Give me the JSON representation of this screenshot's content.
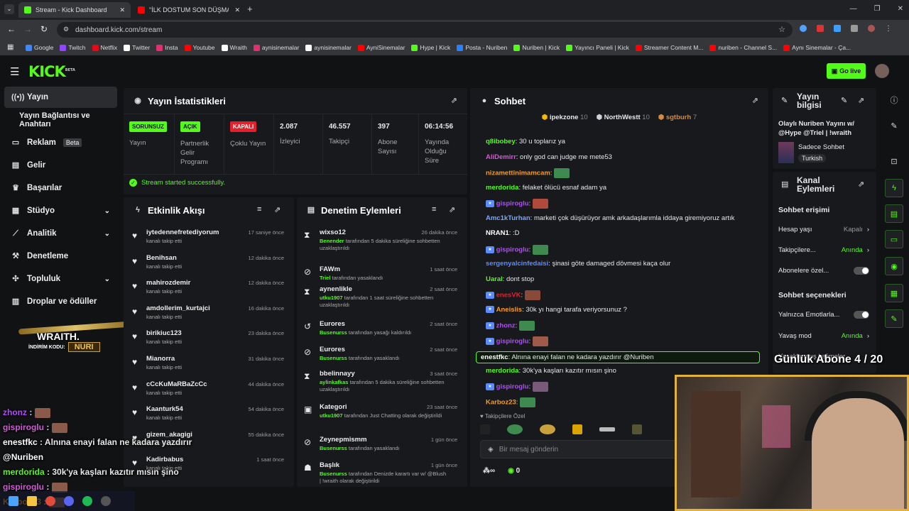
{
  "browser": {
    "tabs": [
      {
        "label": "Stream - Kick Dashboard"
      },
      {
        "label": "\"İLK DOSTUM SON DÜŞMANIM"
      }
    ],
    "url": "dashboard.kick.com/stream",
    "bookmarks": [
      "Google",
      "Twitch",
      "Netflix",
      "Twitter",
      "Insta",
      "Youtube",
      "Wraith",
      "aynisinemalar",
      "aynisinemalar",
      "AyniSinemalar",
      "Hype | Kick",
      "Posta - Nuriben",
      "Nuriben | Kick",
      "Yayıncı Paneli | Kick",
      "Streamer Content M...",
      "nuriben - Channel S...",
      "Aynı Sinemalar - Ça..."
    ]
  },
  "header": {
    "logo": "KICK",
    "logo_sup": "BETA",
    "go_live": "Go live"
  },
  "sidenav": {
    "items": [
      {
        "label": "Yayın",
        "icon": "broadcast-icon"
      },
      {
        "label": "Yayın Bağlantısı ve Anahtarı",
        "icon": ""
      },
      {
        "label": "Reklam",
        "badge": "Beta",
        "icon": "ad-icon"
      },
      {
        "label": "Gelir",
        "icon": "dollar-icon"
      },
      {
        "label": "Başarılar",
        "icon": "trophy-icon"
      },
      {
        "label": "Stüdyo",
        "icon": "studio-icon"
      },
      {
        "label": "Analitik",
        "icon": "analytics-icon"
      },
      {
        "label": "Denetleme",
        "icon": "hammer-icon"
      },
      {
        "label": "Topluluk",
        "icon": "community-icon"
      },
      {
        "label": "Droplar ve ödüller",
        "icon": "drops-icon"
      }
    ]
  },
  "promo": {
    "brand": "WRAITH.",
    "code_label": "İNDİRİM KODU:",
    "code": "NURI"
  },
  "stats": {
    "title": "Yayın İstatistikleri",
    "items": [
      {
        "badge": "SORUNSUZ",
        "label": "Yayın",
        "color": "#53fc18"
      },
      {
        "badge": "AÇIK",
        "label": "Partnerlik Gelir Programı",
        "color": "#53fc18"
      },
      {
        "badge": "KAPALI",
        "label": "Çoklu Yayın",
        "color": "#e5202b"
      },
      {
        "value": "2.087",
        "label": "İzleyici"
      },
      {
        "value": "46.557",
        "label": "Takipçi"
      },
      {
        "value": "397",
        "label": "Abone Sayısı"
      },
      {
        "value": "06:14:56",
        "label": "Yayında Olduğu Süre"
      }
    ],
    "success": "Stream started successfully."
  },
  "activity": {
    "title": "Etkinlik Akışı",
    "rows": [
      {
        "name": "iytedennefretediyorum",
        "sub": "kanalı takip etti",
        "time": "17 saniye önce"
      },
      {
        "name": "Benihsan",
        "sub": "kanalı takip etti",
        "time": "12 dakika önce"
      },
      {
        "name": "mahirozdemir",
        "sub": "kanalı takip etti",
        "time": "12 dakika önce"
      },
      {
        "name": "amdollerim_kurtajci",
        "sub": "kanalı takip etti",
        "time": "16 dakika önce"
      },
      {
        "name": "birikiuc123",
        "sub": "kanalı takip etti",
        "time": "23 dakika önce"
      },
      {
        "name": "Mianorra",
        "sub": "kanalı takip etti",
        "time": "31 dakika önce"
      },
      {
        "name": "cCcKuMaRBaZcCc",
        "sub": "kanalı takip etti",
        "time": "44 dakika önce"
      },
      {
        "name": "Kaanturk54",
        "sub": "kanalı takip etti",
        "time": "54 dakika önce"
      },
      {
        "name": "gizem_akagigi",
        "sub": "kanalı takip etti",
        "time": "55 dakika önce"
      },
      {
        "name": "Kadirbabus",
        "sub": "kanalı takip etti",
        "time": "1 saat önce"
      }
    ]
  },
  "moderation": {
    "title": "Denetim Eylemleri",
    "rows": [
      {
        "name": "wixso12",
        "actor": "Benender",
        "text": "tarafından 5 dakika süreliğine sohbetten uzaklaştırıldı",
        "time": "26 dakika önce",
        "icon": "hourglass-icon"
      },
      {
        "name": "FAWm",
        "actor": "Triel",
        "text": "tarafından yasaklandı",
        "time": "1 saat önce",
        "icon": "ban-icon"
      },
      {
        "name": "aynenlikle",
        "actor": "utku1907",
        "text": "tarafından 1 saat süreliğine sohbetten uzaklaştırıldı",
        "time": "2 saat önce",
        "icon": "hourglass-icon"
      },
      {
        "name": "Eurores",
        "actor": "Busenurss",
        "text": "tarafından yasağı kaldırıldı",
        "time": "2 saat önce",
        "icon": "undo-icon"
      },
      {
        "name": "Eurores",
        "actor": "Busenurss",
        "text": "tarafından yasaklandı",
        "time": "2 saat önce",
        "icon": "ban-icon"
      },
      {
        "name": "bbelinnayy",
        "actor": "aylinkafkas",
        "text": "tarafından 5 dakika süreliğine sohbetten uzaklaştırıldı",
        "time": "3 saat önce",
        "icon": "hourglass-icon"
      },
      {
        "name": "Kategori",
        "actor": "utku1907",
        "text": "tarafından Just Chatting olarak değiştirildi",
        "time": "23 saat önce",
        "icon": "category-icon"
      },
      {
        "name": "Zeynepmismm",
        "actor": "Busenurss",
        "text": "tarafından yasaklandı",
        "time": "1 gün önce",
        "icon": "ban-icon"
      },
      {
        "name": "Başlık",
        "actor": "Busenurss",
        "text": "tarafından Denizde karartı var w/ @Blush | !wraith olarak değiştirildi",
        "time": "1 gün önce",
        "icon": "title-icon"
      }
    ]
  },
  "chat": {
    "title": "Sohbet",
    "top_gifters": [
      {
        "name": "ipekzone",
        "count": "10",
        "color": "#f5b800"
      },
      {
        "name": "NorthWestt",
        "count": "10",
        "color": "#cfd3d8"
      },
      {
        "name": "sgtburh",
        "count": "7",
        "color": "#d98a3a"
      }
    ],
    "messages": [
      {
        "user": "q8ibobey",
        "color": "#53fc18",
        "text": "30 u toplarız ya",
        "emote": false
      },
      {
        "user": "AliDemirr",
        "color": "#d15ad6",
        "text": "only god can judge me mete53",
        "emote": false
      },
      {
        "user": "nizamettinimamcam",
        "color": "#f59b24",
        "text": "",
        "emote": true
      },
      {
        "user": "merdorida",
        "color": "#53fc18",
        "text": "felaket ölücü esnaf adam ya",
        "emote": false
      },
      {
        "user": "gispiroglu",
        "color": "#b34bff",
        "text": "",
        "emote": true
      },
      {
        "user": "Amc1kTurhan",
        "color": "#7aa6ff",
        "text": "marketi çok düşürüyor amk arkadaşlarımla iddaya giremiyoruz artık",
        "emote": false
      },
      {
        "user": "NRAN1",
        "color": "#ffffff",
        "text": ":D",
        "emote": false
      },
      {
        "user": "gispiroglu",
        "color": "#b34bff",
        "text": "",
        "emote": true
      },
      {
        "user": "sergenyalcinfedaisi",
        "color": "#5b8cff",
        "text": "şinasi göte damaged dövmesi kaça olur",
        "emote": false
      },
      {
        "user": "Uaral",
        "color": "#53fc18",
        "text": "dont stop",
        "emote": false
      },
      {
        "user": "enesVK",
        "color": "#e5202b",
        "text": "",
        "emote": true
      },
      {
        "user": "Aneislis",
        "color": "#f59b24",
        "text": "30k yı hangi tarafa veriyorsunuz ?",
        "emote": false
      },
      {
        "user": "zhonz",
        "color": "#b34bff",
        "text": "",
        "emote": true
      },
      {
        "user": "gispiroglu",
        "color": "#b34bff",
        "text": "",
        "emote": true
      },
      {
        "user": "enestfkc",
        "color": "#ffffff",
        "text": "Alnına enayi falan ne kadara yazdırır @Nuriben",
        "emote": false
      },
      {
        "user": "merdorida",
        "color": "#53fc18",
        "text": "30k'ya kaşları kazıtır mısın şino",
        "emote": false
      },
      {
        "user": "gispiroglu",
        "color": "#b34bff",
        "text": "",
        "emote": true
      },
      {
        "user": "Karboz23",
        "color": "#f59b24",
        "text": "",
        "emote": true
      }
    ],
    "followers_only": "Takipçilere Özel",
    "placeholder": "Bir mesaj gönderin",
    "count": "0"
  },
  "stream_info": {
    "title": "Yayın bilgisi",
    "stream_title": "Olaylı Nuriben Yayını w/ @Hype @Triel | !wraith",
    "category": "Sadece Sohbet",
    "language": "Turkish"
  },
  "channel_actions": {
    "title": "Kanal Eylemleri",
    "chat_access": "Sohbet erişimi",
    "account_age": {
      "label": "Hesap yaşı",
      "value": "Kapalı"
    },
    "followers": {
      "label": "Takipçilere...",
      "value": "Anında"
    },
    "subs": {
      "label": "Abonelere özel..."
    },
    "chat_options": "Sohbet seçenekleri",
    "emotes_only": {
      "label": "Yalnızca Emotlarla..."
    },
    "slow_mode": {
      "label": "Yavaş mod",
      "value": "Anında"
    },
    "blocked_words": "Yasaklanmış kelimeler"
  },
  "overlay": {
    "daily_sub": "Günlük Abone 4 / 20",
    "chat": [
      {
        "user": "zhonz",
        "color": "#b34bff",
        "text": ":"
      },
      {
        "user": "gispiroglu",
        "color": "#d15ad6",
        "text": ":"
      },
      {
        "user": "enestfkc",
        "color": "#ffffff",
        "text": ": Alnına enayi falan ne kadara yazdırır"
      },
      {
        "user": "@Nuriben",
        "color": "#ffffff",
        "text": ""
      },
      {
        "user": "merdorida",
        "color": "#53fc18",
        "text": ": 30k'ya kaşları kazıtır mısın şino"
      },
      {
        "user": "gispiroglu",
        "color": "#d15ad6",
        "text": ":"
      },
      {
        "user": "Karboz23",
        "color": "#f59b24",
        "text": ":"
      }
    ]
  }
}
